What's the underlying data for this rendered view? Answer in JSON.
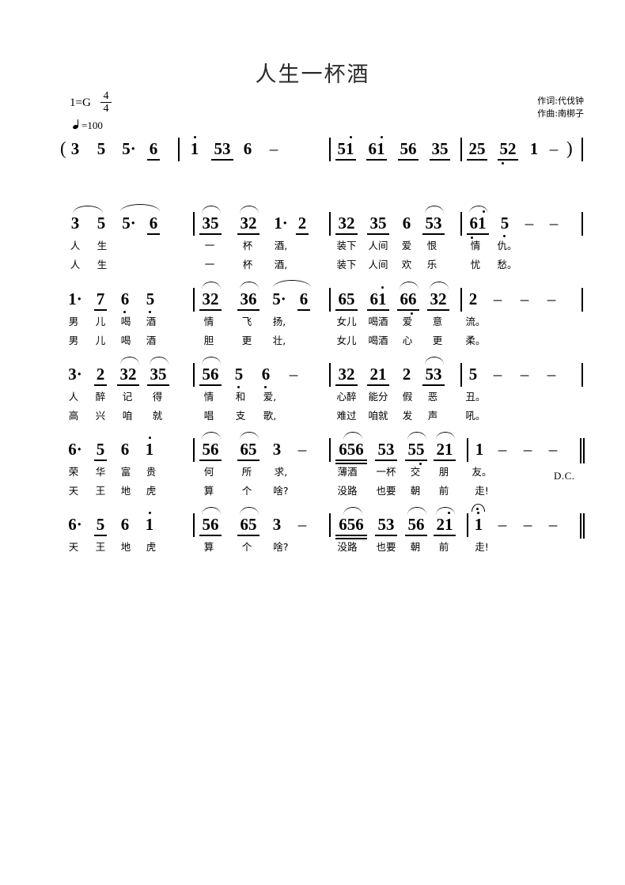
{
  "header": {
    "title": "人生一杯酒",
    "key_signature": "1=G",
    "time_signature_top": "4",
    "time_signature_bottom": "4",
    "tempo": "=100",
    "lyricist": "作词:代伐钟",
    "composer": "作曲:南梆子"
  },
  "marks": {
    "open_paren": "(",
    "close_paren": ")",
    "dc": "D.C.",
    "dash": "–"
  },
  "systems": [
    {
      "name": "intro-line",
      "measures": [
        {
          "notes": [
            "3",
            "5",
            "5·",
            "6"
          ]
        },
        {
          "notes": [
            "1",
            "53",
            "6",
            "–"
          ]
        },
        {
          "notes": [
            "51",
            "61",
            "56",
            "35"
          ]
        },
        {
          "notes": [
            "25",
            "52",
            "1",
            "–"
          ]
        }
      ]
    },
    {
      "name": "line-1",
      "measures": [
        {
          "notes": [
            "3",
            "5",
            "5·",
            "6"
          ],
          "verse1": [
            "人",
            "生",
            "",
            ""
          ],
          "verse2": [
            "人",
            "生",
            "",
            ""
          ]
        },
        {
          "notes": [
            "35",
            "32",
            "1·",
            "2"
          ],
          "verse1": [
            "一",
            "杯",
            "酒,",
            ""
          ],
          "verse2": [
            "一",
            "杯",
            "酒,",
            ""
          ]
        },
        {
          "notes": [
            "32",
            "35",
            "6",
            "53"
          ],
          "verse1": [
            "装下",
            "人间",
            "爱",
            "恨"
          ],
          "verse2": [
            "装下",
            "人间",
            "欢",
            "乐"
          ]
        },
        {
          "notes": [
            "61",
            "5",
            "–",
            "–"
          ],
          "verse1": [
            "情",
            "仇。",
            "",
            ""
          ],
          "verse2": [
            "忧",
            "愁。",
            "",
            ""
          ]
        }
      ]
    },
    {
      "name": "line-2",
      "measures": [
        {
          "notes": [
            "1·",
            "7",
            "6",
            "5"
          ],
          "verse1": [
            "男",
            "儿",
            "喝",
            "酒"
          ],
          "verse2": [
            "男",
            "儿",
            "喝",
            "酒"
          ]
        },
        {
          "notes": [
            "32",
            "36",
            "5·",
            "6"
          ],
          "verse1": [
            "情",
            "飞",
            "扬,",
            ""
          ],
          "verse2": [
            "胆",
            "更",
            "壮,",
            ""
          ]
        },
        {
          "notes": [
            "65",
            "61",
            "66",
            "32"
          ],
          "verse1": [
            "女儿",
            "喝酒",
            "爱",
            "意"
          ],
          "verse2": [
            "女儿",
            "喝酒",
            "心",
            "更"
          ]
        },
        {
          "notes": [
            "2",
            "–",
            "–",
            "–"
          ],
          "verse1": [
            "流。",
            "",
            "",
            ""
          ],
          "verse2": [
            "柔。",
            "",
            "",
            ""
          ]
        }
      ]
    },
    {
      "name": "line-3",
      "measures": [
        {
          "notes": [
            "3·",
            "2",
            "32",
            "35"
          ],
          "verse1": [
            "人",
            "醉",
            "记",
            "得"
          ],
          "verse2": [
            "高",
            "兴",
            "咱",
            "就"
          ]
        },
        {
          "notes": [
            "56",
            "5",
            "6",
            "–"
          ],
          "verse1": [
            "情",
            "和",
            "爱,",
            ""
          ],
          "verse2": [
            "唱",
            "支",
            "歌,",
            ""
          ]
        },
        {
          "notes": [
            "32",
            "21",
            "2",
            "53"
          ],
          "verse1": [
            "心醉",
            "能分",
            "假",
            "恶"
          ],
          "verse2": [
            "难过",
            "咱就",
            "发",
            "声"
          ]
        },
        {
          "notes": [
            "5",
            "–",
            "–",
            "–"
          ],
          "verse1": [
            "丑。",
            "",
            "",
            ""
          ],
          "verse2": [
            "吼。",
            "",
            "",
            ""
          ]
        }
      ]
    },
    {
      "name": "line-4",
      "measures": [
        {
          "notes": [
            "6·",
            "5",
            "6",
            "1"
          ],
          "verse1": [
            "荣",
            "华",
            "富",
            "贵"
          ],
          "verse2": [
            "天",
            "王",
            "地",
            "虎"
          ]
        },
        {
          "notes": [
            "56",
            "65",
            "3",
            "–"
          ],
          "verse1": [
            "何",
            "所",
            "求,",
            ""
          ],
          "verse2": [
            "算",
            "个",
            "啥?",
            ""
          ]
        },
        {
          "notes": [
            "656",
            "53",
            "55",
            "21"
          ],
          "verse1": [
            "薄酒",
            "一杯",
            "交",
            "朋"
          ],
          "verse2": [
            "没路",
            "也要",
            "朝",
            "前"
          ]
        },
        {
          "notes": [
            "1",
            "–",
            "–",
            "–"
          ],
          "verse1": [
            "友。",
            "",
            "",
            ""
          ],
          "verse2": [
            "走!",
            "",
            "",
            ""
          ]
        }
      ]
    },
    {
      "name": "line-5",
      "measures": [
        {
          "notes": [
            "6·",
            "5",
            "6",
            "1"
          ],
          "verse1": [
            "天",
            "王",
            "地",
            "虎"
          ]
        },
        {
          "notes": [
            "56",
            "65",
            "3",
            "–"
          ],
          "verse1": [
            "算",
            "个",
            "啥?"
          ]
        },
        {
          "notes": [
            "656",
            "53",
            "56",
            "21"
          ],
          "verse1": [
            "没路",
            "也要",
            "朝",
            "前"
          ]
        },
        {
          "notes": [
            "1",
            "–",
            "–",
            "–"
          ],
          "verse1": [
            "走!",
            "",
            "",
            ""
          ]
        }
      ]
    }
  ]
}
